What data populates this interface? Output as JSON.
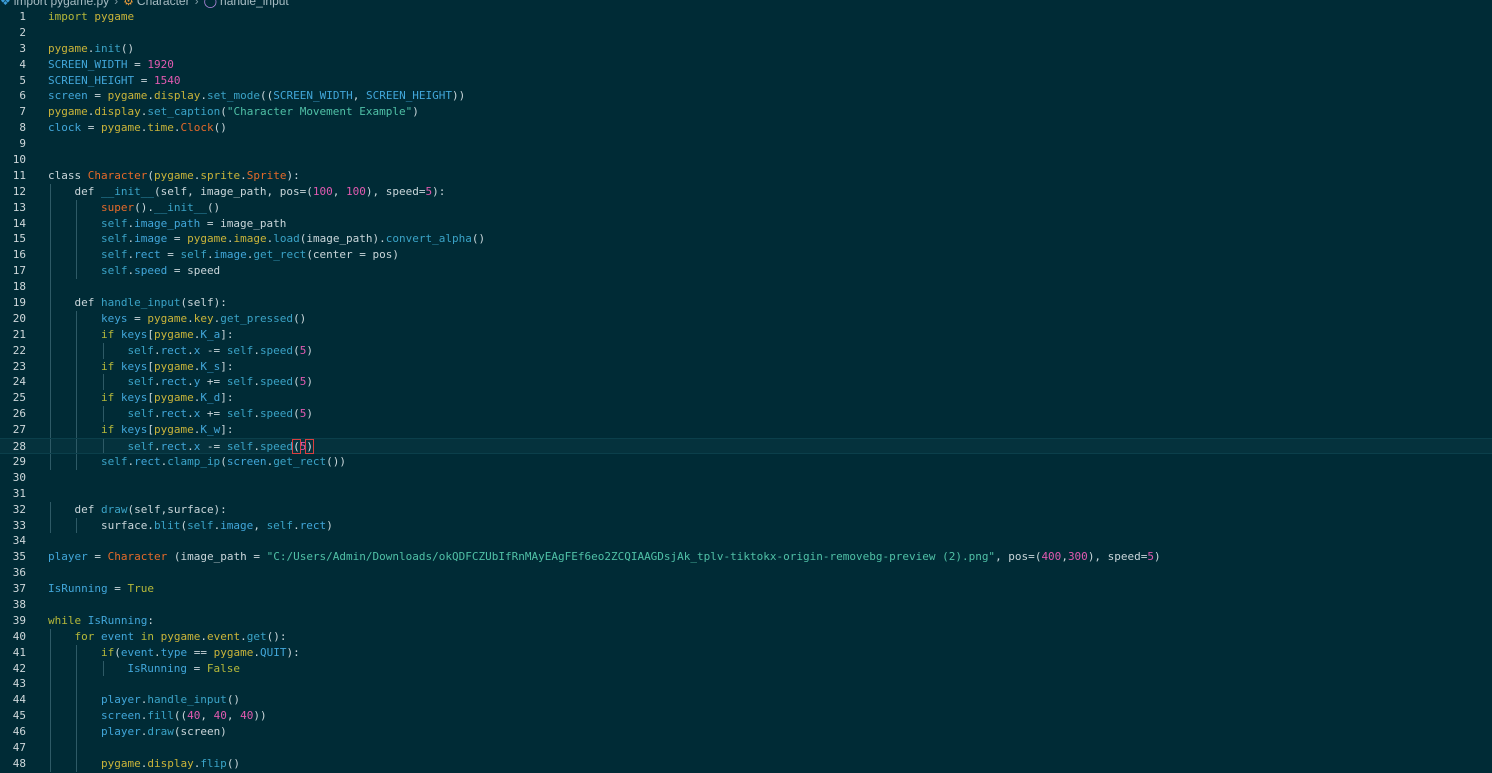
{
  "breadcrumb": {
    "file": "import pygame.py",
    "class": "Character",
    "method": "handle_input"
  },
  "colors": {
    "background": "#002b36",
    "keyword": "#b5b83a",
    "number": "#e05ab0",
    "string": "#4fc0a6",
    "class": "#e46a2a",
    "variable": "#41a6d9"
  },
  "current_line": 28,
  "lines": [
    {
      "n": 1,
      "indent": 0,
      "t": [
        [
          "kw",
          "import "
        ],
        [
          "mod",
          "pygame"
        ]
      ]
    },
    {
      "n": 2,
      "indent": 0,
      "t": []
    },
    {
      "n": 3,
      "indent": 0,
      "t": [
        [
          "mod",
          "pygame"
        ],
        [
          "punc",
          "."
        ],
        [
          "func",
          "init"
        ],
        [
          "punc",
          "()"
        ]
      ]
    },
    {
      "n": 4,
      "indent": 0,
      "t": [
        [
          "var",
          "SCREEN_WIDTH"
        ],
        [
          "punc",
          " = "
        ],
        [
          "num",
          "1920"
        ]
      ]
    },
    {
      "n": 5,
      "indent": 0,
      "t": [
        [
          "var",
          "SCREEN_HEIGHT"
        ],
        [
          "punc",
          " = "
        ],
        [
          "num",
          "1540"
        ]
      ]
    },
    {
      "n": 6,
      "indent": 0,
      "t": [
        [
          "var",
          "screen"
        ],
        [
          "punc",
          " = "
        ],
        [
          "mod",
          "pygame"
        ],
        [
          "punc",
          "."
        ],
        [
          "mod",
          "display"
        ],
        [
          "punc",
          "."
        ],
        [
          "func",
          "set_mode"
        ],
        [
          "punc",
          "(("
        ],
        [
          "var",
          "SCREEN_WIDTH"
        ],
        [
          "punc",
          ", "
        ],
        [
          "var",
          "SCREEN_HEIGHT"
        ],
        [
          "punc",
          "))"
        ]
      ]
    },
    {
      "n": 7,
      "indent": 0,
      "t": [
        [
          "mod",
          "pygame"
        ],
        [
          "punc",
          "."
        ],
        [
          "mod",
          "display"
        ],
        [
          "punc",
          "."
        ],
        [
          "func",
          "set_caption"
        ],
        [
          "punc",
          "("
        ],
        [
          "str",
          "\"Character Movement Example\""
        ],
        [
          "punc",
          ")"
        ]
      ]
    },
    {
      "n": 8,
      "indent": 0,
      "t": [
        [
          "var",
          "clock"
        ],
        [
          "punc",
          " = "
        ],
        [
          "mod",
          "pygame"
        ],
        [
          "punc",
          "."
        ],
        [
          "mod",
          "time"
        ],
        [
          "punc",
          "."
        ],
        [
          "cls",
          "Clock"
        ],
        [
          "punc",
          "()"
        ]
      ]
    },
    {
      "n": 9,
      "indent": 0,
      "t": []
    },
    {
      "n": 10,
      "indent": 0,
      "t": []
    },
    {
      "n": 11,
      "indent": 0,
      "t": [
        [
          "plain",
          "class "
        ],
        [
          "cls",
          "Character"
        ],
        [
          "punc",
          "("
        ],
        [
          "mod",
          "pygame"
        ],
        [
          "punc",
          "."
        ],
        [
          "mod",
          "sprite"
        ],
        [
          "punc",
          "."
        ],
        [
          "cls",
          "Sprite"
        ],
        [
          "punc",
          "):"
        ]
      ]
    },
    {
      "n": 12,
      "indent": 1,
      "t": [
        [
          "plain",
          "def "
        ],
        [
          "func",
          "__init__"
        ],
        [
          "punc",
          "(self, image_path, pos="
        ],
        [
          "punc",
          "("
        ],
        [
          "num",
          "100"
        ],
        [
          "punc",
          ", "
        ],
        [
          "num",
          "100"
        ],
        [
          "punc",
          "), speed="
        ],
        [
          "num",
          "5"
        ],
        [
          "punc",
          "):"
        ]
      ]
    },
    {
      "n": 13,
      "indent": 2,
      "t": [
        [
          "cls",
          "super"
        ],
        [
          "punc",
          "()."
        ],
        [
          "func",
          "__init__"
        ],
        [
          "punc",
          "()"
        ]
      ]
    },
    {
      "n": 14,
      "indent": 2,
      "t": [
        [
          "self",
          "self"
        ],
        [
          "punc",
          "."
        ],
        [
          "var",
          "image_path"
        ],
        [
          "punc",
          " = image_path"
        ]
      ]
    },
    {
      "n": 15,
      "indent": 2,
      "t": [
        [
          "self",
          "self"
        ],
        [
          "punc",
          "."
        ],
        [
          "var",
          "image"
        ],
        [
          "punc",
          " = "
        ],
        [
          "mod",
          "pygame"
        ],
        [
          "punc",
          "."
        ],
        [
          "mod",
          "image"
        ],
        [
          "punc",
          "."
        ],
        [
          "func",
          "load"
        ],
        [
          "punc",
          "(image_path)."
        ],
        [
          "func",
          "convert_alpha"
        ],
        [
          "punc",
          "()"
        ]
      ]
    },
    {
      "n": 16,
      "indent": 2,
      "t": [
        [
          "self",
          "self"
        ],
        [
          "punc",
          "."
        ],
        [
          "var",
          "rect"
        ],
        [
          "punc",
          " = "
        ],
        [
          "self",
          "self"
        ],
        [
          "punc",
          "."
        ],
        [
          "var",
          "image"
        ],
        [
          "punc",
          "."
        ],
        [
          "func",
          "get_rect"
        ],
        [
          "punc",
          "(center = pos)"
        ]
      ]
    },
    {
      "n": 17,
      "indent": 2,
      "t": [
        [
          "self",
          "self"
        ],
        [
          "punc",
          "."
        ],
        [
          "var",
          "speed"
        ],
        [
          "punc",
          " = speed"
        ]
      ]
    },
    {
      "n": 18,
      "indent": 1,
      "t": []
    },
    {
      "n": 19,
      "indent": 1,
      "t": [
        [
          "plain",
          "def "
        ],
        [
          "func",
          "handle_input"
        ],
        [
          "punc",
          "(self):"
        ]
      ]
    },
    {
      "n": 20,
      "indent": 2,
      "t": [
        [
          "var",
          "keys"
        ],
        [
          "punc",
          " = "
        ],
        [
          "mod",
          "pygame"
        ],
        [
          "punc",
          "."
        ],
        [
          "mod",
          "key"
        ],
        [
          "punc",
          "."
        ],
        [
          "func",
          "get_pressed"
        ],
        [
          "punc",
          "()"
        ]
      ]
    },
    {
      "n": 21,
      "indent": 2,
      "t": [
        [
          "kw",
          "if "
        ],
        [
          "var",
          "keys"
        ],
        [
          "punc",
          "["
        ],
        [
          "mod",
          "pygame"
        ],
        [
          "punc",
          "."
        ],
        [
          "var",
          "K_a"
        ],
        [
          "punc",
          "]:"
        ]
      ]
    },
    {
      "n": 22,
      "indent": 3,
      "t": [
        [
          "self",
          "self"
        ],
        [
          "punc",
          "."
        ],
        [
          "var",
          "rect"
        ],
        [
          "punc",
          "."
        ],
        [
          "var",
          "x"
        ],
        [
          "punc",
          " -= "
        ],
        [
          "self",
          "self"
        ],
        [
          "punc",
          "."
        ],
        [
          "func",
          "speed"
        ],
        [
          "punc",
          "("
        ],
        [
          "num",
          "5"
        ],
        [
          "punc",
          ")"
        ]
      ]
    },
    {
      "n": 23,
      "indent": 2,
      "t": [
        [
          "kw",
          "if "
        ],
        [
          "var",
          "keys"
        ],
        [
          "punc",
          "["
        ],
        [
          "mod",
          "pygame"
        ],
        [
          "punc",
          "."
        ],
        [
          "var",
          "K_s"
        ],
        [
          "punc",
          "]:"
        ]
      ]
    },
    {
      "n": 24,
      "indent": 3,
      "t": [
        [
          "self",
          "self"
        ],
        [
          "punc",
          "."
        ],
        [
          "var",
          "rect"
        ],
        [
          "punc",
          "."
        ],
        [
          "var",
          "y"
        ],
        [
          "punc",
          " += "
        ],
        [
          "self",
          "self"
        ],
        [
          "punc",
          "."
        ],
        [
          "func",
          "speed"
        ],
        [
          "punc",
          "("
        ],
        [
          "num",
          "5"
        ],
        [
          "punc",
          ")"
        ]
      ]
    },
    {
      "n": 25,
      "indent": 2,
      "t": [
        [
          "kw",
          "if "
        ],
        [
          "var",
          "keys"
        ],
        [
          "punc",
          "["
        ],
        [
          "mod",
          "pygame"
        ],
        [
          "punc",
          "."
        ],
        [
          "var",
          "K_d"
        ],
        [
          "punc",
          "]:"
        ]
      ]
    },
    {
      "n": 26,
      "indent": 3,
      "t": [
        [
          "self",
          "self"
        ],
        [
          "punc",
          "."
        ],
        [
          "var",
          "rect"
        ],
        [
          "punc",
          "."
        ],
        [
          "var",
          "x"
        ],
        [
          "punc",
          " += "
        ],
        [
          "self",
          "self"
        ],
        [
          "punc",
          "."
        ],
        [
          "func",
          "speed"
        ],
        [
          "punc",
          "("
        ],
        [
          "num",
          "5"
        ],
        [
          "punc",
          ")"
        ]
      ]
    },
    {
      "n": 27,
      "indent": 2,
      "t": [
        [
          "kw",
          "if "
        ],
        [
          "var",
          "keys"
        ],
        [
          "punc",
          "["
        ],
        [
          "mod",
          "pygame"
        ],
        [
          "punc",
          "."
        ],
        [
          "var",
          "K_w"
        ],
        [
          "punc",
          "]:"
        ]
      ]
    },
    {
      "n": 28,
      "indent": 3,
      "t": [
        [
          "self",
          "self"
        ],
        [
          "punc",
          "."
        ],
        [
          "var",
          "rect"
        ],
        [
          "punc",
          "."
        ],
        [
          "var",
          "x"
        ],
        [
          "punc",
          " -= "
        ],
        [
          "self",
          "self"
        ],
        [
          "punc",
          "."
        ],
        [
          "func",
          "speed"
        ],
        [
          "cursor",
          "("
        ],
        [
          "num",
          "5"
        ],
        [
          "cursor",
          ")"
        ]
      ]
    },
    {
      "n": 29,
      "indent": 2,
      "t": [
        [
          "self",
          "self"
        ],
        [
          "punc",
          "."
        ],
        [
          "var",
          "rect"
        ],
        [
          "punc",
          "."
        ],
        [
          "func",
          "clamp_ip"
        ],
        [
          "punc",
          "("
        ],
        [
          "var",
          "screen"
        ],
        [
          "punc",
          "."
        ],
        [
          "func",
          "get_rect"
        ],
        [
          "punc",
          "())"
        ]
      ]
    },
    {
      "n": 30,
      "indent": 0,
      "t": []
    },
    {
      "n": 31,
      "indent": 0,
      "t": []
    },
    {
      "n": 32,
      "indent": 1,
      "t": [
        [
          "plain",
          "def "
        ],
        [
          "func",
          "draw"
        ],
        [
          "punc",
          "(self,surface):"
        ]
      ]
    },
    {
      "n": 33,
      "indent": 2,
      "t": [
        [
          "punc",
          "surface."
        ],
        [
          "func",
          "blit"
        ],
        [
          "punc",
          "("
        ],
        [
          "self",
          "self"
        ],
        [
          "punc",
          "."
        ],
        [
          "var",
          "image"
        ],
        [
          "punc",
          ", "
        ],
        [
          "self",
          "self"
        ],
        [
          "punc",
          "."
        ],
        [
          "var",
          "rect"
        ],
        [
          "punc",
          ")"
        ]
      ]
    },
    {
      "n": 34,
      "indent": 0,
      "t": []
    },
    {
      "n": 35,
      "indent": 0,
      "t": [
        [
          "var",
          "player"
        ],
        [
          "punc",
          " = "
        ],
        [
          "cls",
          "Character"
        ],
        [
          "punc",
          " (image_path = "
        ],
        [
          "str",
          "\"C:/Users/Admin/Downloads/okQDFCZUbIfRnMAyEAgFEf6eo2ZCQIAAGDsjAk_tplv-tiktokx-origin-removebg-preview (2).png\""
        ],
        [
          "punc",
          ", pos="
        ],
        [
          "punc",
          "("
        ],
        [
          "num",
          "400"
        ],
        [
          "punc",
          ","
        ],
        [
          "num",
          "300"
        ],
        [
          "punc",
          "), speed="
        ],
        [
          "num",
          "5"
        ],
        [
          "punc",
          ")"
        ]
      ]
    },
    {
      "n": 36,
      "indent": 0,
      "t": []
    },
    {
      "n": 37,
      "indent": 0,
      "t": [
        [
          "var",
          "IsRunning"
        ],
        [
          "punc",
          " = "
        ],
        [
          "kw",
          "True"
        ]
      ]
    },
    {
      "n": 38,
      "indent": 0,
      "t": []
    },
    {
      "n": 39,
      "indent": 0,
      "t": [
        [
          "kw",
          "while "
        ],
        [
          "var",
          "IsRunning"
        ],
        [
          "punc",
          ":"
        ]
      ]
    },
    {
      "n": 40,
      "indent": 1,
      "t": [
        [
          "kw",
          "for "
        ],
        [
          "var",
          "event"
        ],
        [
          "kw",
          " in "
        ],
        [
          "mod",
          "pygame"
        ],
        [
          "punc",
          "."
        ],
        [
          "mod",
          "event"
        ],
        [
          "punc",
          "."
        ],
        [
          "func",
          "get"
        ],
        [
          "punc",
          "():"
        ]
      ]
    },
    {
      "n": 41,
      "indent": 2,
      "t": [
        [
          "kw",
          "if"
        ],
        [
          "punc",
          "("
        ],
        [
          "var",
          "event"
        ],
        [
          "punc",
          "."
        ],
        [
          "var",
          "type"
        ],
        [
          "punc",
          " == "
        ],
        [
          "mod",
          "pygame"
        ],
        [
          "punc",
          "."
        ],
        [
          "var",
          "QUIT"
        ],
        [
          "punc",
          "):"
        ]
      ]
    },
    {
      "n": 42,
      "indent": 3,
      "t": [
        [
          "var",
          "IsRunning"
        ],
        [
          "punc",
          " = "
        ],
        [
          "kw",
          "False"
        ]
      ]
    },
    {
      "n": 43,
      "indent": 2,
      "t": []
    },
    {
      "n": 44,
      "indent": 2,
      "t": [
        [
          "var",
          "player"
        ],
        [
          "punc",
          "."
        ],
        [
          "func",
          "handle_input"
        ],
        [
          "punc",
          "()"
        ]
      ]
    },
    {
      "n": 45,
      "indent": 2,
      "t": [
        [
          "var",
          "screen"
        ],
        [
          "punc",
          "."
        ],
        [
          "func",
          "fill"
        ],
        [
          "punc",
          "(("
        ],
        [
          "num",
          "40"
        ],
        [
          "punc",
          ", "
        ],
        [
          "num",
          "40"
        ],
        [
          "punc",
          ", "
        ],
        [
          "num",
          "40"
        ],
        [
          "punc",
          "))"
        ]
      ]
    },
    {
      "n": 46,
      "indent": 2,
      "t": [
        [
          "var",
          "player"
        ],
        [
          "punc",
          "."
        ],
        [
          "func",
          "draw"
        ],
        [
          "punc",
          "(screen)"
        ]
      ]
    },
    {
      "n": 47,
      "indent": 2,
      "t": []
    },
    {
      "n": 48,
      "indent": 2,
      "t": [
        [
          "mod",
          "pygame"
        ],
        [
          "punc",
          "."
        ],
        [
          "mod",
          "display"
        ],
        [
          "punc",
          "."
        ],
        [
          "func",
          "flip"
        ],
        [
          "punc",
          "()"
        ]
      ]
    }
  ]
}
